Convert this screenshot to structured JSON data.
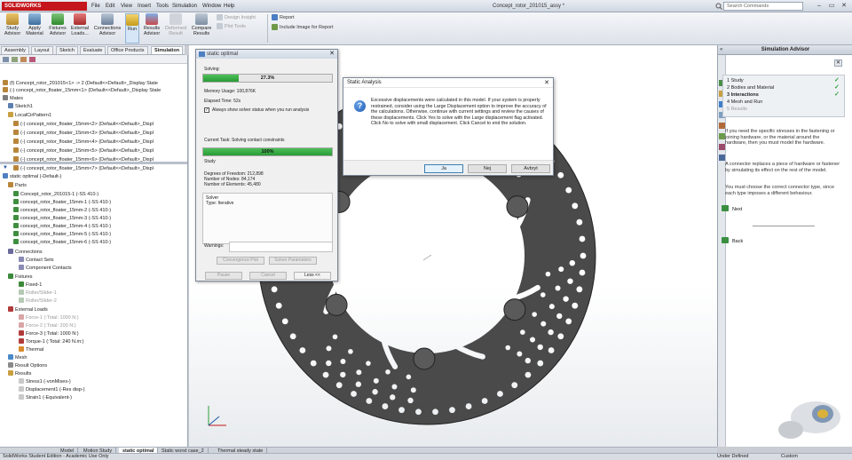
{
  "titlebar": {
    "brand": "SOLIDWORKS",
    "menus": [
      "File",
      "Edit",
      "View",
      "Insert",
      "Tools",
      "Simulation",
      "Window",
      "Help"
    ],
    "document_title": "Concept_rotor_201015_assy *",
    "search_placeholder": "Search Commands"
  },
  "ribbon": {
    "buttons": [
      {
        "label": "Study Advisor"
      },
      {
        "label": "Apply Material"
      },
      {
        "label": "Fixtures Advisor"
      },
      {
        "label": "External Loads..."
      },
      {
        "label": "Connections Advisor"
      },
      {
        "label": "Run"
      },
      {
        "label": "Results Advisor"
      },
      {
        "label": "Deformed Result"
      },
      {
        "label": "Compare Results"
      }
    ],
    "small_items": [
      "Design Insight",
      "Plot Tools",
      "Report",
      "Include Image for Report"
    ]
  },
  "command_tabs": [
    "Assembly",
    "Layout",
    "Sketch",
    "Evaluate",
    "Office Products",
    "Simulation"
  ],
  "feature_tree": [
    "(f) Concept_rotor_201015<1> -> 2 (Default<<Default>_Display State",
    "(-) concept_rotor_floater_15mm<1> (Default<<Default>_Display State",
    "Mates",
    "Sketch1",
    "LocalCirPattern1",
    "(-) concept_rotor_floater_15mm<2> (Default<<Default>_Displ",
    "(-) concept_rotor_floater_15mm<3> (Default<<Default>_Displ",
    "(-) concept_rotor_floater_15mm<4> (Default<<Default>_Displ",
    "(-) concept_rotor_floater_15mm<5> (Default<<Default>_Displ",
    "(-) concept_rotor_floater_15mm<6> (Default<<Default>_Displ",
    "(-) concept_rotor_floater_15mm<7> (Default<<Default>_Displ"
  ],
  "study_tree": {
    "root": "static optimal (-Default-)",
    "items": [
      "Parts",
      "Concept_rotor_201015-1 (-SS 410-)",
      "concept_rotor_floater_15mm-1 (-SS 410-)",
      "concept_rotor_floater_15mm-2 (-SS 410-)",
      "concept_rotor_floater_15mm-3 (-SS 410-)",
      "concept_rotor_floater_15mm-4 (-SS 410-)",
      "concept_rotor_floater_15mm-5 (-SS 410-)",
      "concept_rotor_floater_15mm-6 (-SS 410-)",
      "Connections",
      "Contact Sets",
      "Component Contacts",
      "Fixtures",
      "Fixed-1",
      "Roller/Slider-1",
      "Roller/Slider-2",
      "External Loads",
      "Force-1 (:Total: 1000 N:)",
      "Force-2 (:Total: 200 N:)",
      "Force-3 (:Total: 1000 N:)",
      "Torque-1 (:Total: 240 N.m:)",
      "Thermal",
      "Mesh",
      "Result Options",
      "Results",
      "Stress1 (-vonMises-)",
      "Displacement1 (-Res disp-)",
      "Strain1 (-Equivalent-)"
    ]
  },
  "solver_dialog": {
    "title": "static optimal",
    "solving_label": "Solving:",
    "progress_top_text": "27.3%",
    "progress_top_fraction": 0.273,
    "memory_usage": "Memory Usage: 100,876K",
    "elapsed_time": "Elapsed Time: 52s",
    "checkbox_label": "Always show solver status when you run analysis",
    "current_task": "Current Task: Solving contact constraints",
    "progress_bottom_text": "100%",
    "progress_bottom_fraction": 1.0,
    "study_label": "Study",
    "dof": "Degrees of Freedom: 212,898",
    "nodes": "Number of Nodes: 84,174",
    "elements": "Number of Elements: 45,480",
    "solver_group_label": "Solver",
    "solver_type": "Type: Iterative",
    "warnings_label": "Warnings:",
    "buttons": [
      "Convergence Plot",
      "Solver Parameters",
      "Pause",
      "Cancel",
      "Less <<"
    ]
  },
  "static_analysis_dialog": {
    "title": "Static Analysis",
    "message": "Excessive displacements were calculated in this model. If your system is properly restrained, consider using the Large Displacement option to improve the accuracy of the calculations. Otherwise, continue with current settings and review the causes of these displacements. Click Yes to solve with the Large displacement flag activated. Click No to solve with small displacement. Click Cancel to end the solution.",
    "buttons": [
      "Ja",
      "Nej",
      "Avbryt"
    ]
  },
  "simulation_advisor": {
    "title": "Simulation Advisor",
    "steps": [
      {
        "label": "1 Study",
        "done": true
      },
      {
        "label": "2 Bodies and Material",
        "done": true
      },
      {
        "label": "3 Interactions",
        "done": true
      },
      {
        "label": "4 Mesh and Run",
        "done": false
      },
      {
        "label": "5 Results",
        "done": false
      }
    ],
    "paragraph1": "If you need the specific stresses in the fastening or joining hardware, or the material around the hardware, then you must model the hardware.",
    "paragraph2": "A connector replaces a piece of hardware or fastener by simulating its effect on the rest of the model.",
    "paragraph3": "You must choose the correct connector type, since each type imposes a different behaviour.",
    "next_label": "Next",
    "back_label": "Back"
  },
  "study_tabs": [
    "Model",
    "Motion Study",
    "static optimal",
    "Static worst case_2",
    "Thermal steady state"
  ],
  "status": {
    "left": "SolidWorks Student Edition - Academic Use Only",
    "right_a": "Under Defined",
    "right_b": "Custom"
  },
  "colors": {
    "accent_red": "#c4161c",
    "progress_green": "#2a9b36",
    "rotor_fill": "#4a4a4a"
  }
}
